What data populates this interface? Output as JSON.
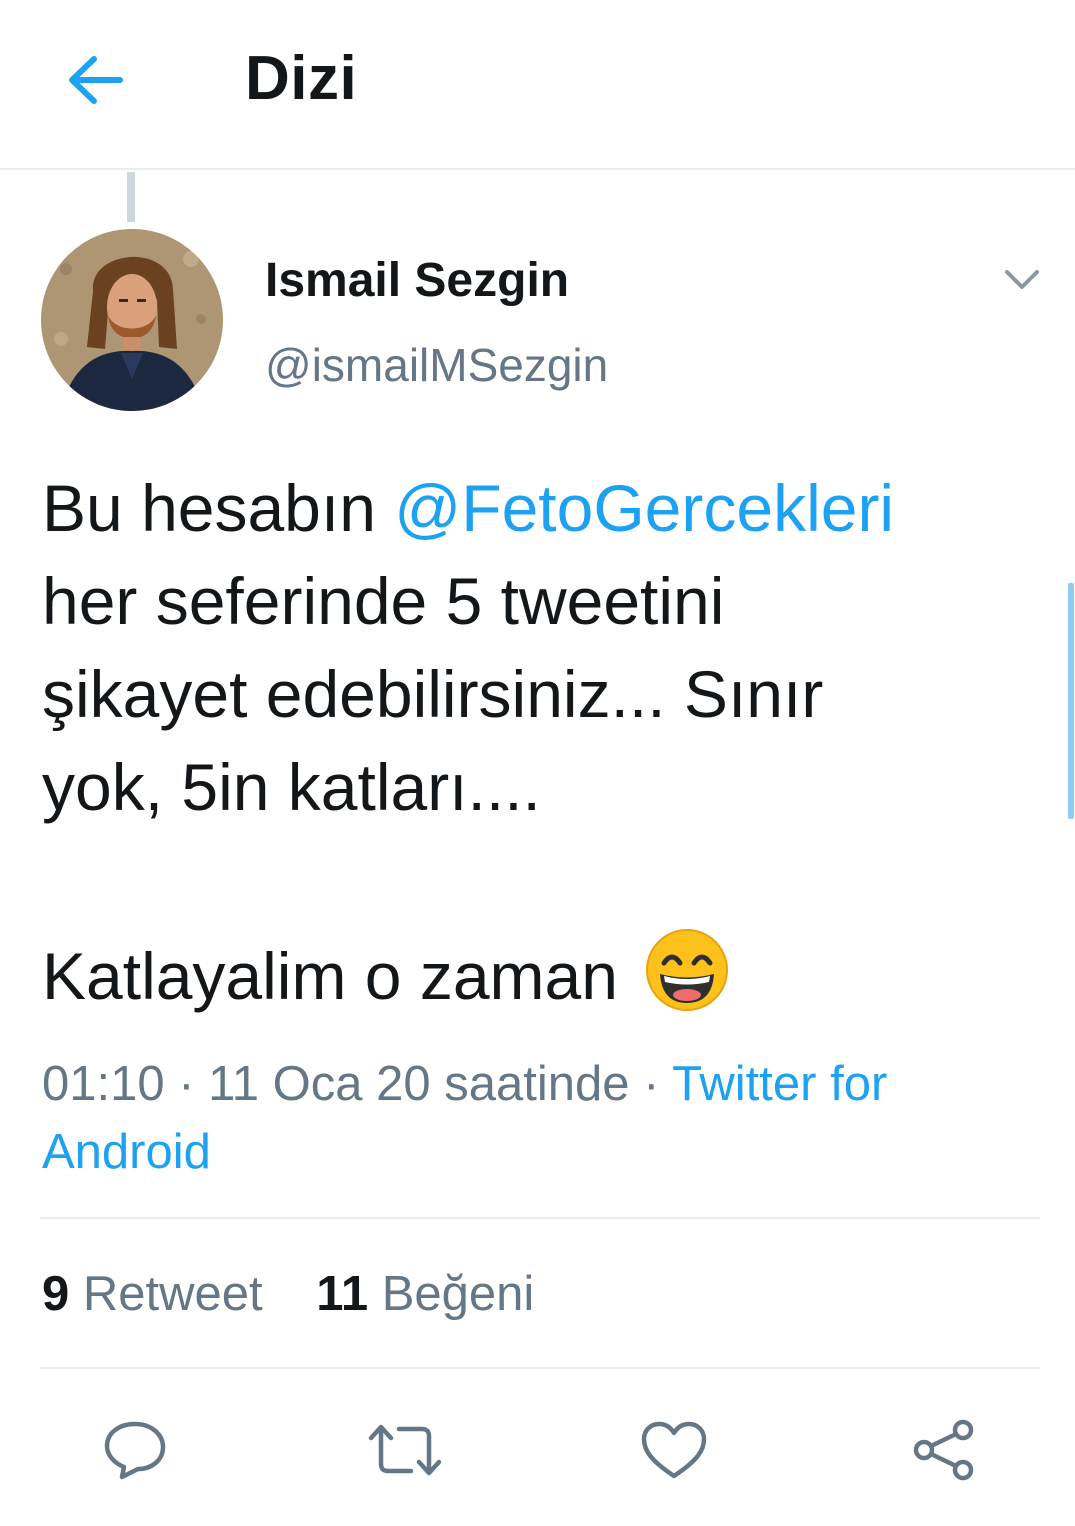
{
  "header": {
    "title": "Dizi",
    "back_icon": "arrow-left-icon"
  },
  "tweet": {
    "author": {
      "display_name": "Ismail Sezgin",
      "handle": "@ismailMSezgin",
      "avatar": "avatar"
    },
    "menu_icon": "chevron-down-icon",
    "text": {
      "line1_prefix": "Bu hesabın ",
      "mention": "@FetoGercekleri",
      "line2": "her seferinde 5 tweetini",
      "line3": "şikayet edebilirsiniz... Sınır",
      "line4": "yok, 5in katları....",
      "line5": "Katlayalim o zaman ",
      "emoji": "grinning-face-smiling-eyes-emoji"
    },
    "meta": {
      "time_date": "01:10 · 11 Oca 20 saatinde · ",
      "source_part1": "Twitter for",
      "source_part2": "Android"
    },
    "stats": {
      "retweet_count": "9",
      "retweet_label": "Retweet",
      "like_count": "11",
      "like_label": "Beğeni"
    },
    "actions": [
      "reply-icon",
      "retweet-icon",
      "like-icon",
      "share-icon"
    ]
  },
  "colors": {
    "accent": "#1da1f2",
    "text_primary": "#14171a",
    "text_secondary": "#657786",
    "divider": "#e6ecf0"
  }
}
